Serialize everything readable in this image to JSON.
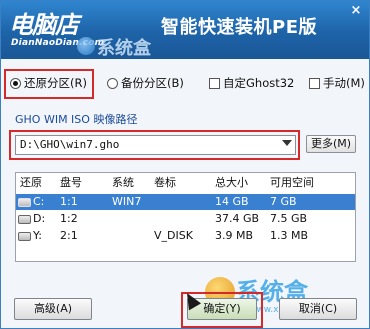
{
  "header": {
    "logo": "电脑店",
    "logo_sub": "DianNaoDian.com",
    "title": "智能快速装机PE版",
    "close": "×",
    "watermark": "系统盒"
  },
  "options": {
    "restore": "还原分区(R)",
    "backup": "备份分区(B)",
    "custom_ghost": "自定Ghost32",
    "manual": "手动(M)",
    "selected": "restore"
  },
  "path": {
    "label": "GHO WIM ISO 映像路径",
    "value": "D:\\GHO\\win7.gho",
    "more_button": "更多(M)"
  },
  "table": {
    "headers": [
      "还原",
      "盘号",
      "系统",
      "卷标",
      "总大小",
      "可用空间"
    ],
    "rows": [
      {
        "drive": "C:",
        "disk": "1:1",
        "system": "WIN7",
        "label": "",
        "total": "14 GB",
        "free": "7 GB",
        "selected": true
      },
      {
        "drive": "D:",
        "disk": "1:2",
        "system": "",
        "label": "",
        "total": "37.4 GB",
        "free": "7.5 GB",
        "selected": false
      },
      {
        "drive": "Y:",
        "disk": "2:1",
        "system": "",
        "label": "V_DISK",
        "total": "3.9 MB",
        "free": "1.3 MB",
        "selected": false
      }
    ]
  },
  "buttons": {
    "advanced": "高级(A)",
    "ok": "确定(Y)",
    "cancel": "取消(C)"
  },
  "watermark_bottom": {
    "name": "系统盒",
    "url": "www.xitonghe.com"
  },
  "colors": {
    "header": "#1e63a8",
    "highlight_box": "#d42a2a",
    "row_selected": "#3a80d0"
  }
}
